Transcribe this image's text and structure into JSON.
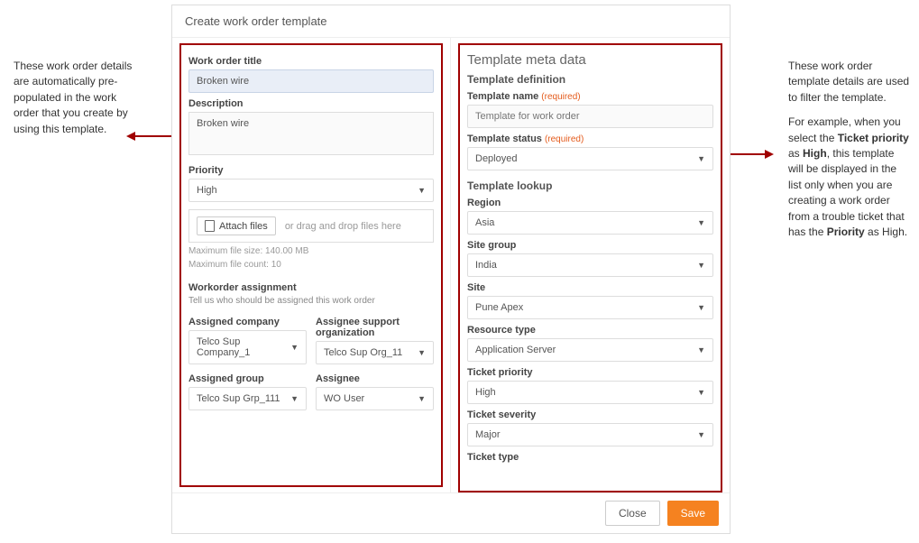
{
  "callouts": {
    "left": "These work order details are automatically pre-populated in the work order that you create by using this template.",
    "right_p1": "These work order template details are used to filter the template.",
    "right_p2a": "For example, when you select the ",
    "right_p2b": "Ticket priority",
    "right_p2c": " as ",
    "right_p2d": "High",
    "right_p2e": ", this template will be displayed in the list only when you are creating a work order from a trouble ticket that has the ",
    "right_p2f": "Priority",
    "right_p2g": " as High."
  },
  "dialog": {
    "title": "Create work order template",
    "close_label": "Close",
    "save_label": "Save"
  },
  "work_order": {
    "title_label": "Work order title",
    "title_value": "Broken wire",
    "description_label": "Description",
    "description_value": "Broken wire",
    "priority_label": "Priority",
    "priority_value": "High",
    "attach_files_label": "Attach files",
    "attach_hint": "or drag and drop files here",
    "max_size": "Maximum file size:   140.00 MB",
    "max_count": "Maximum file count:   10",
    "assignment_heading": "Workorder assignment",
    "assignment_sub": "Tell us who should be assigned this work order",
    "assigned_company_label": "Assigned company",
    "assigned_company_value": "Telco Sup Company_1",
    "assignee_support_org_label": "Assignee support organization",
    "assignee_support_org_value": "Telco Sup Org_11",
    "assigned_group_label": "Assigned group",
    "assigned_group_value": "Telco Sup Grp_111",
    "assignee_label": "Assignee",
    "assignee_value": "WO User"
  },
  "meta": {
    "heading": "Template meta data",
    "definition_heading": "Template definition",
    "template_name_label": "Template name",
    "required_text": "(required)",
    "template_name_placeholder": "Template for work order",
    "template_status_label": "Template status",
    "template_status_value": "Deployed",
    "lookup_heading": "Template lookup",
    "region_label": "Region",
    "region_value": "Asia",
    "site_group_label": "Site group",
    "site_group_value": "India",
    "site_label": "Site",
    "site_value": "Pune Apex",
    "resource_type_label": "Resource type",
    "resource_type_value": "Application Server",
    "ticket_priority_label": "Ticket priority",
    "ticket_priority_value": "High",
    "ticket_severity_label": "Ticket severity",
    "ticket_severity_value": "Major",
    "ticket_type_label": "Ticket type"
  }
}
